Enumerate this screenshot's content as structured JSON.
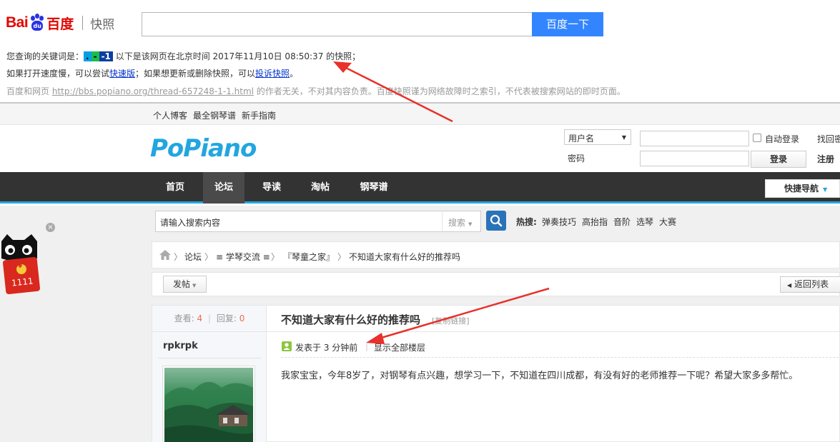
{
  "baidu": {
    "logo_bai": "Bai",
    "logo_du": "du",
    "logo_cn": "百度",
    "logo_kuaizhao": "快照",
    "search_value": "",
    "search_button": "百度一下",
    "info1_prefix": "您查询的关键词是：",
    "keyword_1": ".",
    "keyword_2": "-",
    "keyword_3": "-1",
    "info1_suffix": " 以下是该网页在北京时间 2017年11月10日 08:50:37 的快照；",
    "info2_prefix": "如果打开速度慢，可以尝试",
    "fast_version_link": "快速版",
    "info2_middle": "；如果想更新或删除快照，可以",
    "complain_link": "投诉快照",
    "info2_suffix": "。",
    "info3_prefix": "百度和网页 ",
    "source_url": "http://bbs.popiano.org/thread-657248-1-1.html",
    "info3_suffix": " 的作者无关，不对其内容负责。百度快照谨为网络故障时之索引，不代表被搜索网站的即时页面。"
  },
  "site": {
    "topbar": [
      "个人博客",
      "最全钢琴谱",
      "新手指南"
    ],
    "logo": "PoPiano",
    "login": {
      "username_select": "用户名",
      "password_label": "密码",
      "auto_login": "自动登录",
      "login_button": "登录",
      "find_password": "找回密",
      "register": "注册"
    },
    "nav": [
      "首页",
      "论坛",
      "导读",
      "淘帖",
      "钢琴谱"
    ],
    "quick_nav": "快捷导航",
    "search": {
      "placeholder": "请输入搜索内容",
      "type": "搜索",
      "hot_label": "热搜:",
      "hot_items": [
        "弹奏技巧",
        "高抬指",
        "音阶",
        "选琴",
        "大赛"
      ]
    },
    "ad": {
      "close": "×",
      "badge": "1111",
      "coin": "¥"
    },
    "breadcrumb": {
      "sep": "〉",
      "forum": "论坛",
      "section": "≡ 学琴交流 ≡",
      "board": "『琴童之家』",
      "thread": "不知道大家有什么好的推荐吗"
    },
    "actions": {
      "post": "发帖",
      "back": "返回列表"
    },
    "thread": {
      "views_label": "查看:",
      "views": "4",
      "sep": "|",
      "replies_label": "回复:",
      "replies": "0",
      "author": "rpkrpk",
      "title": "不知道大家有什么好的推荐吗",
      "copy_link": "[复制链接]",
      "posted": "发表于 3 分钟前",
      "meta_sep": "|",
      "show_all": "显示全部楼层",
      "body": "我家宝宝，今年8岁了，对钢琴有点兴趣，想学习一下，不知道在四川成都，有没有好的老师推荐一下呢？希望大家多多帮忙。"
    }
  },
  "colors": {
    "baidu_red": "#e10601",
    "baidu_blue": "#3385ff",
    "popiano_blue": "#22a6e0",
    "arrow_red": "#e8312a"
  }
}
